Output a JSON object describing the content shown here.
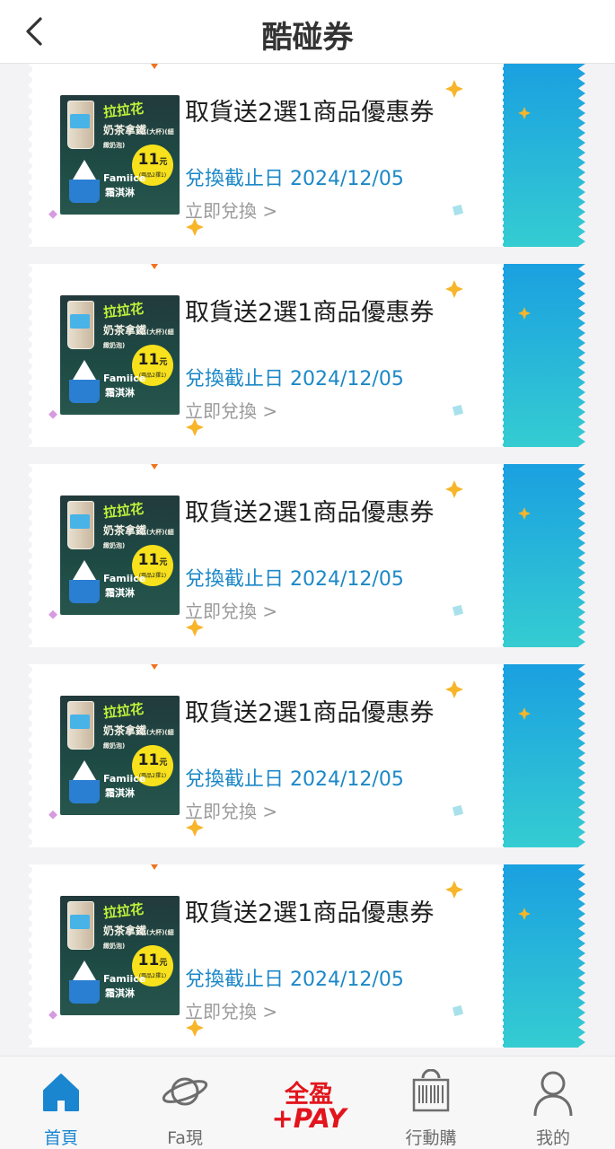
{
  "header": {
    "title": "酷碰券",
    "back_icon": "chevron-left-icon"
  },
  "coupon_template": {
    "image_text": {
      "brand_overlay": "拉拉花",
      "product": "奶茶拿鐵",
      "product_note": "(大杯)(細緻奶泡)",
      "price": "11",
      "price_unit": "元",
      "price_note": "(兩品2擇1)",
      "ice_brand": "Famiice",
      "ice_name": "霜淇淋"
    }
  },
  "coupons": [
    {
      "title": "取貨送2選1商品優惠券",
      "date_label": "兌換截止日",
      "date": "2024/12/05",
      "action": "立即兌換 >"
    },
    {
      "title": "取貨送2選1商品優惠券",
      "date_label": "兌換截止日",
      "date": "2024/12/05",
      "action": "立即兌換 >"
    },
    {
      "title": "取貨送2選1商品優惠券",
      "date_label": "兌換截止日",
      "date": "2024/12/05",
      "action": "立即兌換 >"
    },
    {
      "title": "取貨送2選1商品優惠券",
      "date_label": "兌換截止日",
      "date": "2024/12/05",
      "action": "立即兌換 >"
    },
    {
      "title": "取貨送2選1商品優惠券",
      "date_label": "兌換截止日",
      "date": "2024/12/05",
      "action": "立即兌換 >"
    }
  ],
  "tabbar": {
    "items": [
      {
        "label": "首頁",
        "icon": "home-icon",
        "active": true
      },
      {
        "label": "Fa現",
        "icon": "planet-icon",
        "active": false
      },
      {
        "label": "全盈+PAY",
        "icon": "pay-logo",
        "active": false
      },
      {
        "label": "行動購",
        "icon": "barcode-bag-icon",
        "active": false
      },
      {
        "label": "我的",
        "icon": "user-icon",
        "active": false
      }
    ],
    "pay_top": "全盈",
    "pay_bottom": "+PAY"
  },
  "colors": {
    "accent": "#1a86d0",
    "date_blue": "#1c88c7",
    "pay_red": "#e2151c",
    "stub_gradient_top": "#1aa0e0",
    "stub_gradient_bottom": "#35ccd2"
  }
}
